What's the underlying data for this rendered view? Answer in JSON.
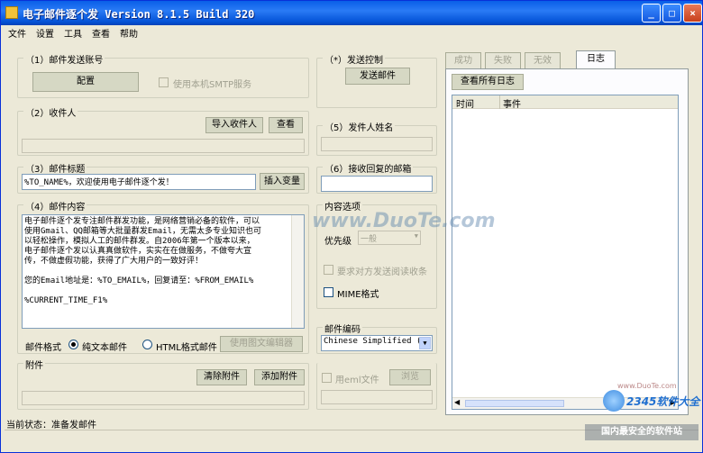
{
  "window": {
    "title": "电子邮件逐个发 Version 8.1.5 Build 320",
    "buttons": {
      "minimize": "_",
      "maximize": "□",
      "close": "×"
    }
  },
  "menu": [
    "文件",
    "设置",
    "工具",
    "查看",
    "帮助"
  ],
  "sender_account": {
    "legend": "（1）邮件发送账号",
    "config_button": "配置",
    "use_local_smtp": {
      "label": "使用本机SMTP服务",
      "checked": false,
      "disabled": true
    }
  },
  "recipients": {
    "legend": "（2）收件人",
    "import_button": "导入收件人",
    "view_button": "查看",
    "value": ""
  },
  "subject": {
    "legend": "（3）邮件标题",
    "value": "%TO_NAME%，欢迎使用电子邮件逐个发！",
    "insert_var_button": "插入变量"
  },
  "content": {
    "legend": "（4）邮件内容",
    "lines": [
      "电子邮件逐个发专注邮件群发功能，是网络营销必备的软件，可以",
      "使用Gmail、QQ邮箱等大批量群发Email，无需太多专业知识也可",
      "以轻松操作，模拟人工的邮件群发。自2006年第一个版本以来，",
      "电子邮件逐个发以认真真做软件，实实在在做服务，不做夸大宣",
      "传，不做虚假功能，获得了广大用户的一致好评！",
      "",
      "您的Email地址是：%TO_EMAIL%，回复请至：%FROM_EMAIL%",
      "",
      "%CURRENT_TIME_F1%"
    ],
    "format_label": "邮件格式",
    "format_plain": "纯文本邮件",
    "format_html": "HTML格式邮件",
    "selected_format": "plain",
    "image_editor_button": "使用图文编辑器"
  },
  "attachments": {
    "legend": "附件",
    "clear_button": "清除附件",
    "add_button": "添加附件"
  },
  "send_control": {
    "legend": "（*）发送控制",
    "send_button": "发送邮件"
  },
  "sender_name": {
    "legend": "（5）发件人姓名",
    "value": ""
  },
  "reply_to": {
    "legend": "（6）接收回复的邮箱",
    "value": ""
  },
  "content_options": {
    "legend": "内容选项",
    "priority_label": "优先级",
    "priority_value": "一般",
    "read_receipt": {
      "label": "要求对方发送阅读收条",
      "checked": false,
      "disabled": true
    },
    "mime": {
      "label": "MIME格式",
      "checked": false
    }
  },
  "encoding": {
    "legend": "邮件编码",
    "value": "Chinese Simplified (G"
  },
  "eml": {
    "label": "用eml文件",
    "browse_button": "浏览"
  },
  "tabs": [
    {
      "label": "成功",
      "active": false
    },
    {
      "label": "失败",
      "active": false
    },
    {
      "label": "无效",
      "active": false
    },
    {
      "label": "日志",
      "active": true
    }
  ],
  "log": {
    "view_all_button": "查看所有日志",
    "columns": [
      "时间",
      "事件"
    ]
  },
  "status": {
    "text": "当前状态：准备发邮件"
  },
  "watermarks": {
    "center": "www.DuoTe.com",
    "small": "www.DuoTe.com",
    "brand": "2345软件大全",
    "slogan": "国内最安全的软件站"
  },
  "colors": {
    "titlebar": "#0a5fe8",
    "face": "#ece9d8",
    "button": "#d6d8c4"
  }
}
